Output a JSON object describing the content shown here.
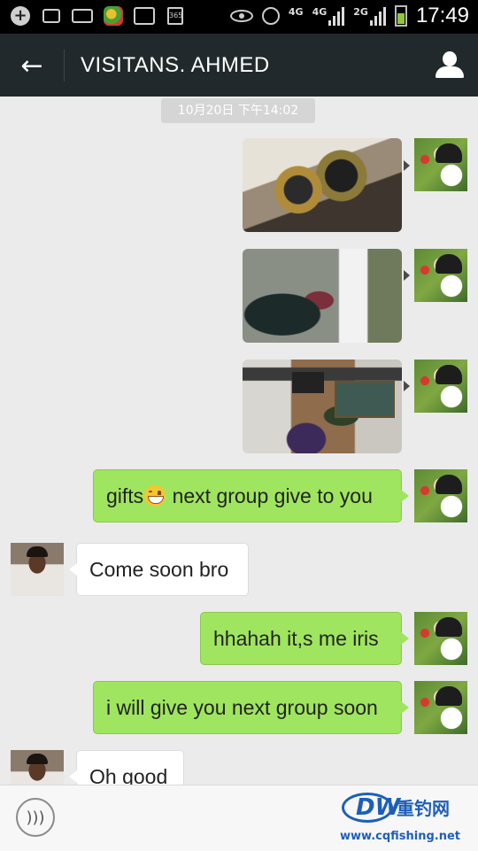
{
  "status_bar": {
    "time": "17:49",
    "network_labels": [
      "4G",
      "4G",
      "2G"
    ],
    "calendar_label": "365",
    "icons": [
      "add-icon",
      "mail-icon",
      "envelope-icon",
      "app-icon",
      "gallery-icon",
      "calendar-icon",
      "eye-icon",
      "alarm-icon",
      "signal-icon",
      "battery-icon"
    ]
  },
  "header": {
    "title": "VISITANS. AHMED",
    "back_icon": "back-arrow-icon",
    "profile_icon": "profile-icon",
    "background": "#21292c"
  },
  "chat": {
    "timestamp": "10月20日 下午14:02",
    "outgoing_bubble_color": "#9fe55f",
    "incoming_bubble_color": "#ffffff",
    "messages": [
      {
        "direction": "outgoing",
        "type": "image",
        "description_icon": "fishing-reel-photo"
      },
      {
        "direction": "outgoing",
        "type": "image",
        "description_icon": "meeting-photo"
      },
      {
        "direction": "outgoing",
        "type": "image",
        "description_icon": "shop-photo"
      },
      {
        "direction": "outgoing",
        "type": "text",
        "text_before": "gifts",
        "emoji": "grinning-emoji",
        "text_after": " next group give to you"
      },
      {
        "direction": "incoming",
        "type": "text",
        "text": "Come soon bro"
      },
      {
        "direction": "outgoing",
        "type": "text",
        "text": "hhahah it,s me iris"
      },
      {
        "direction": "outgoing",
        "type": "text",
        "text": "i will give you next group soon"
      },
      {
        "direction": "incoming",
        "type": "text",
        "text": "Oh good"
      }
    ]
  },
  "input_bar": {
    "voice_icon": "voice-icon"
  },
  "watermark": {
    "logo_text": "DW",
    "name": "重钓网",
    "url": "www.cqfishing.net"
  }
}
